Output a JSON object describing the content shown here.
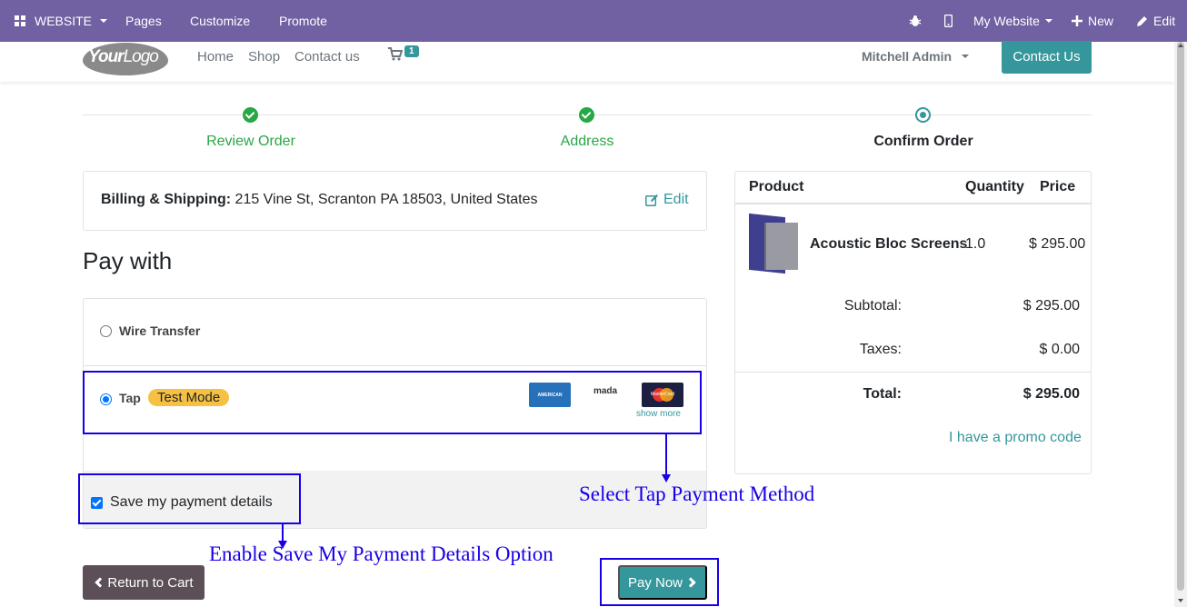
{
  "admin_bar": {
    "website_label": "WEBSITE",
    "pages": "Pages",
    "customize": "Customize",
    "promote": "Promote",
    "site_name": "My Website",
    "new": "New",
    "edit": "Edit",
    "background": "#7160a2"
  },
  "navbar": {
    "logo_bold": "Your",
    "logo_thin": "Logo",
    "links": [
      "Home",
      "Shop",
      "Contact us"
    ],
    "cart_count": "1",
    "user": "Mitchell Admin",
    "contact_button": "Contact Us"
  },
  "steps": [
    {
      "label": "Review Order",
      "state": "done"
    },
    {
      "label": "Address",
      "state": "done"
    },
    {
      "label": "Confirm Order",
      "state": "current"
    }
  ],
  "billing": {
    "label": "Billing & Shipping:",
    "address": " 215 Vine St, Scranton PA 18503, United States",
    "edit": "Edit"
  },
  "pay_with": {
    "title": "Pay with",
    "methods": [
      {
        "name": "Wire Transfer",
        "selected": false
      },
      {
        "name": "Tap",
        "selected": true,
        "badge": "Test Mode"
      }
    ],
    "card_icons": [
      "AMERICAN EXPRESS",
      "mada",
      "MasterCard"
    ],
    "show_more": "show more",
    "save_details_label": "Save my payment details",
    "save_details_checked": true
  },
  "buttons": {
    "return": "Return to Cart",
    "pay": "Pay Now"
  },
  "summary": {
    "headers": {
      "product": "Product",
      "quantity": "Quantity",
      "price": "Price"
    },
    "product_name": "Acoustic Bloc Screens",
    "quantity": "1.0",
    "price": "$ 295.00",
    "subtotal_label": "Subtotal:",
    "subtotal": "$ 295.00",
    "taxes_label": "Taxes:",
    "taxes": "$ 0.00",
    "total_label": "Total:",
    "total": "$ 295.00",
    "promo": "I have a promo code"
  },
  "annotations": {
    "tap": "Select Tap Payment Method",
    "save": "Enable Save My Payment Details Option",
    "color": "#1800e6"
  },
  "colors": {
    "primary": "#35979c",
    "success": "#28a745"
  }
}
